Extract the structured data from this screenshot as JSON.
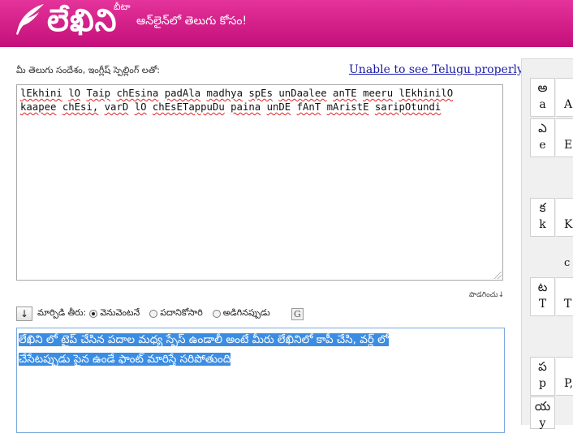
{
  "header": {
    "logo_text": "లేఖిని",
    "beta": "బీటా",
    "tagline": "ఆన్‌లైన్‌లో తెలుగు కోసం!"
  },
  "input": {
    "label": "మీ తెలుగు సందేశం, ఇంగ్లీష్ స్పెల్లింగ్ లతో:",
    "help_link": "Unable to see Telugu properly?",
    "line1_words": [
      "lEkhini",
      " ",
      "lO",
      " ",
      "Taip",
      " ",
      "chEsina",
      " ",
      "padAla",
      " ",
      "madhya",
      " ",
      "spEs",
      " ",
      "unDaalee",
      " ",
      "anTE",
      " ",
      "meeru",
      " ",
      "lEkhinilO"
    ],
    "line2_words": [
      "kaapee",
      " ",
      "chEsi,",
      " ",
      "varD",
      " ",
      "lO",
      " ",
      "chEsETappuDu",
      " ",
      "paina",
      " ",
      "unDE",
      " ",
      "fAnT",
      " ",
      "mAristE",
      " ",
      "saripOtundi"
    ]
  },
  "expand_link": "పొడగించు↓",
  "options": {
    "down_button": "↓",
    "label": "మార్పిడి తీరు:",
    "radios": [
      {
        "label": "వెనువెంటనే",
        "checked": true
      },
      {
        "label": "పదానికోసారి",
        "checked": false
      },
      {
        "label": "అడిగినప్పుడు",
        "checked": false
      }
    ],
    "g_button": "G"
  },
  "output": {
    "line1": "లేఖిని లో టైప్ చేసిన పదాల మధ్య స్పేస్ ఉండాలీ అంటే మీరు లేఖినిలో కాపీ చేసి, వర్డ్ లో",
    "line2": "చేసేటప్పుడు పైన ఉండే ఫాంట్ మారిస్తే సరిపోతుంది"
  },
  "keymap": [
    {
      "telugu": "అ",
      "roman": "a",
      "side": "A"
    },
    {
      "telugu": "ఎ",
      "roman": "e",
      "side": "E"
    },
    {
      "telugu": "క",
      "roman": "k",
      "side": "K"
    },
    {
      "telugu": "ట",
      "roman": "T",
      "side": "T"
    },
    {
      "telugu": "ప",
      "roman": "p",
      "side": "P,"
    },
    {
      "telugu": "య",
      "roman": "y",
      "side": ""
    }
  ],
  "keymap_extra": [
    "c"
  ],
  "colors": {
    "header": "#d61f8a",
    "selection": "#3b8de3",
    "link": "#1a1aa6"
  }
}
